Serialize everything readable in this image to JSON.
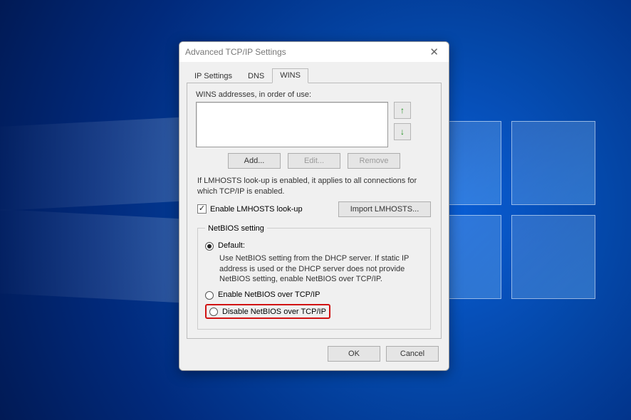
{
  "window": {
    "title": "Advanced TCP/IP Settings"
  },
  "tabs": {
    "ip": "IP Settings",
    "dns": "DNS",
    "wins": "WINS"
  },
  "wins": {
    "addresses_label": "WINS addresses, in order of use:",
    "add": "Add...",
    "edit": "Edit...",
    "remove": "Remove",
    "lmhosts_note": "If LMHOSTS look-up is enabled, it applies to all connections for which TCP/IP is enabled.",
    "enable_lmhosts": "Enable LMHOSTS look-up",
    "import_lmhosts": "Import LMHOSTS...",
    "netbios_legend": "NetBIOS setting",
    "default_label": "Default:",
    "default_desc": "Use NetBIOS setting from the DHCP server. If static IP address is used or the DHCP server does not provide NetBIOS setting, enable NetBIOS over TCP/IP.",
    "enable_netbios": "Enable NetBIOS over TCP/IP",
    "disable_netbios": "Disable NetBIOS over TCP/IP"
  },
  "buttons": {
    "ok": "OK",
    "cancel": "Cancel"
  }
}
